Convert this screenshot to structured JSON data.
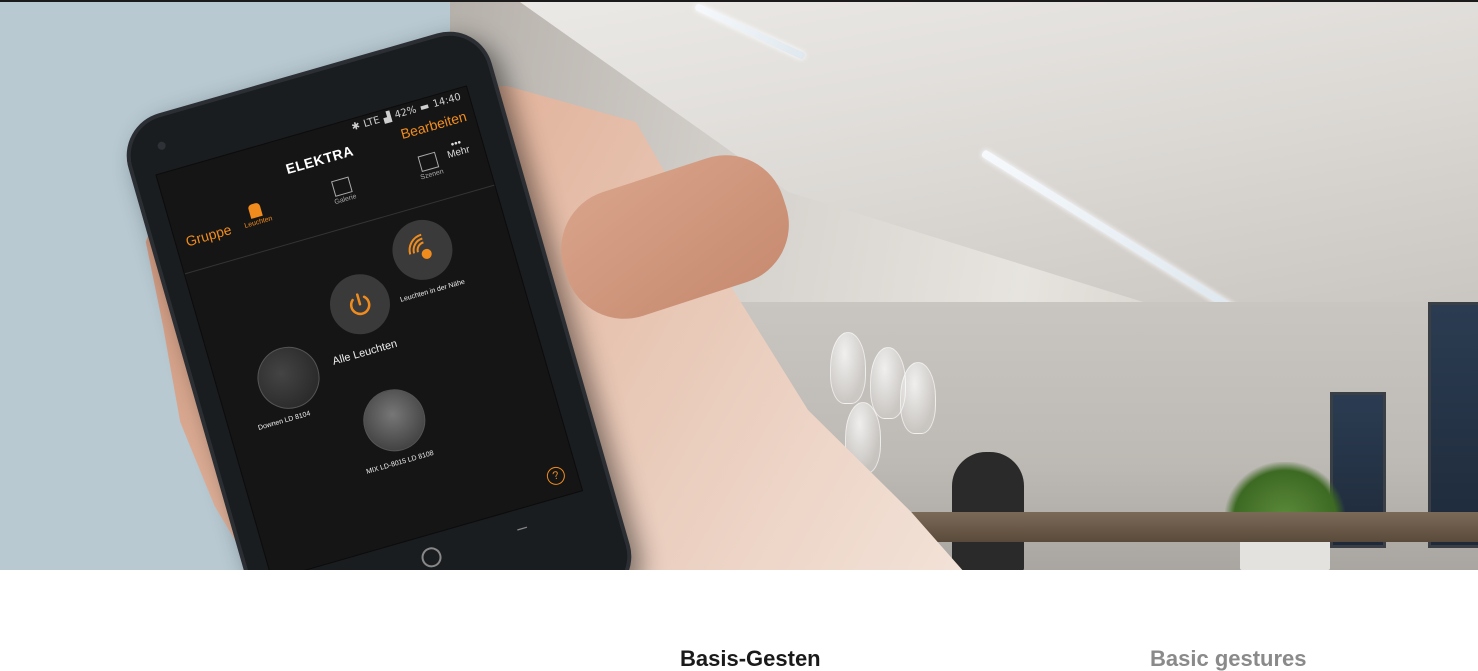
{
  "app": {
    "title": "ELEKTRA",
    "edit_label": "Bearbeiten",
    "group_label": "Gruppe",
    "more_label": "Mehr",
    "status": {
      "network": "LTE",
      "battery": "42%",
      "time": "14:40"
    },
    "tabs": [
      {
        "label": "Leuchten",
        "icon": "lamp-icon",
        "active": true
      },
      {
        "label": "Galerie",
        "icon": "gallery-icon",
        "active": false
      },
      {
        "label": "Szenen",
        "icon": "play-icon",
        "active": false
      }
    ],
    "tiles": {
      "all_lights": "Alle Leuchten",
      "nearby": "Leuchten in der Nähe",
      "lamp1": "Downen LD 8104",
      "lamp2": "MIX LD-8015 LD 8108"
    },
    "help": "?",
    "accent": "#f08c1e"
  },
  "headings": {
    "german": "Basis-Gesten",
    "english": "Basic gestures"
  }
}
